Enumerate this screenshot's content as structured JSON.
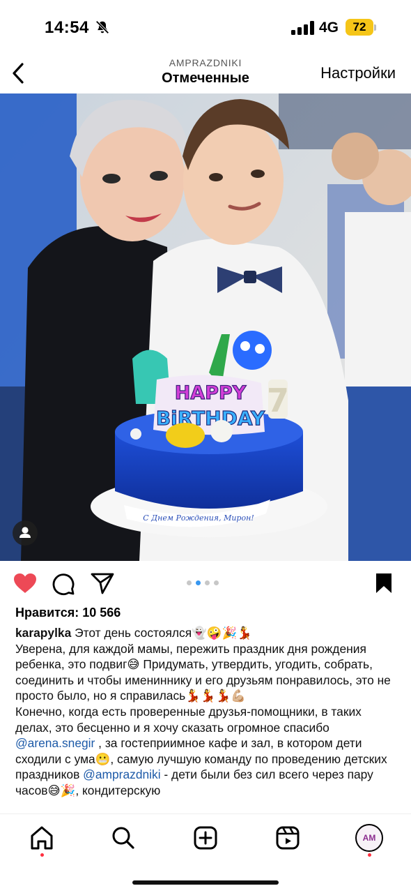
{
  "status_bar": {
    "time": "14:54",
    "network": "4G",
    "battery": "72"
  },
  "header": {
    "account": "AMPRAZDNIKI",
    "title": "Отмеченные",
    "settings": "Настройки"
  },
  "post": {
    "carousel": {
      "count": 4,
      "active_index": 1
    },
    "cake_topper": {
      "line1": "HAPPY",
      "line2": "BiRTHDAY",
      "number": "7"
    },
    "cake_ribbon": "С Днем Рождения, Мирон!",
    "likes_text": "Нравится: 10 566",
    "caption": {
      "username": "karapylka",
      "line1": " Этот день состоялся👻🤪🎉💃",
      "para1_a": "Уверена, для каждой мамы, пережить праздник дня рождения ребенка, это подвиг😅 Придумать, утвердить, угодить, собрать, соединить и чтобы имениннику и его друзьям понравилось, это не просто было, но я справилась💃💃💃💪🏼",
      "para2_a": "Конечно, когда есть проверенные друзья-помощники, в таких делах, это бесценно и я хочу сказать огромное спасибо ",
      "mention1": "@arena.snegir",
      "para2_b": " , за гостеприимное кафе и зал, в котором дети сходили с ума😬, самую лучшую команду по проведению детских праздников ",
      "mention2": "@amprazdniki",
      "para2_c": " - дети были без сил всего через пару часов😅🎉, кондитерскую"
    }
  },
  "tabbar": {
    "items": [
      "home",
      "search",
      "create",
      "reels",
      "profile"
    ],
    "profile_initials": "AM"
  },
  "colors": {
    "like": "#ed4956",
    "mention": "#1d5aa8",
    "battery": "#f5c518",
    "notification_dot": "#ff3040",
    "carousel_active": "#3897f0"
  }
}
